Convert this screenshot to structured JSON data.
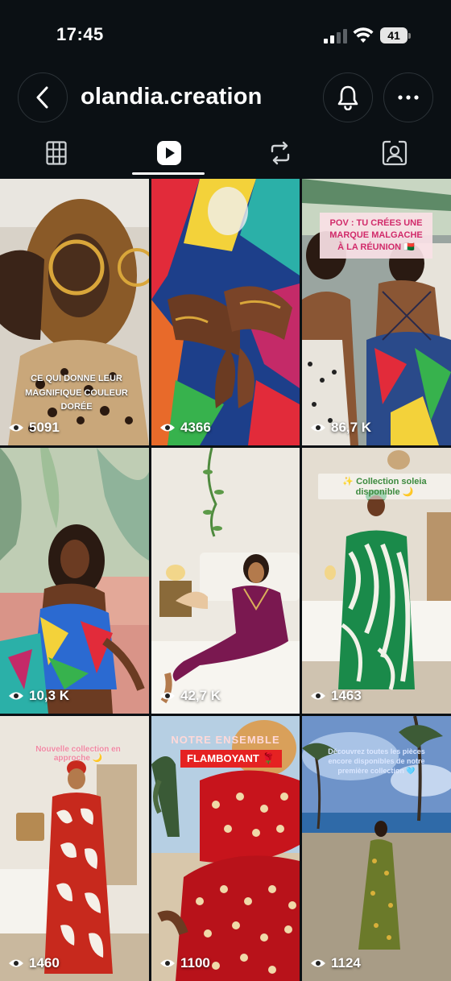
{
  "status_bar": {
    "time": "17:45",
    "battery": "41"
  },
  "header": {
    "username": "olandia.creation"
  },
  "tabs": [
    {
      "name": "grid",
      "icon": "grid-icon"
    },
    {
      "name": "reels",
      "icon": "reels-icon",
      "active": true
    },
    {
      "name": "reposts",
      "icon": "repost-icon"
    },
    {
      "name": "tagged",
      "icon": "tagged-icon"
    }
  ],
  "posts": [
    {
      "views": "5091",
      "caption": "CE QUI DONNE LEUR MAGNIFIQUE COULEUR DORÉE"
    },
    {
      "views": "4366"
    },
    {
      "views": "86,7 K",
      "caption": "POV : TU CRÉES UNE MARQUE MALGACHE À LA RÉUNION 🇲🇬"
    },
    {
      "views": "10,3 K"
    },
    {
      "views": "42,7 K"
    },
    {
      "views": "1463",
      "caption": "✨ Collection soleia disponible 🌙"
    },
    {
      "views": "1460",
      "caption": "Nouvelle collection en approche 🌙"
    },
    {
      "views": "1100",
      "caption_title": "NOTRE ENSEMBLE",
      "caption_label": "FLAMBOYANT 🌹"
    },
    {
      "views": "1124",
      "caption": "Découvrez toutes les pièces encore disponibles de notre première collection 🩵"
    }
  ]
}
